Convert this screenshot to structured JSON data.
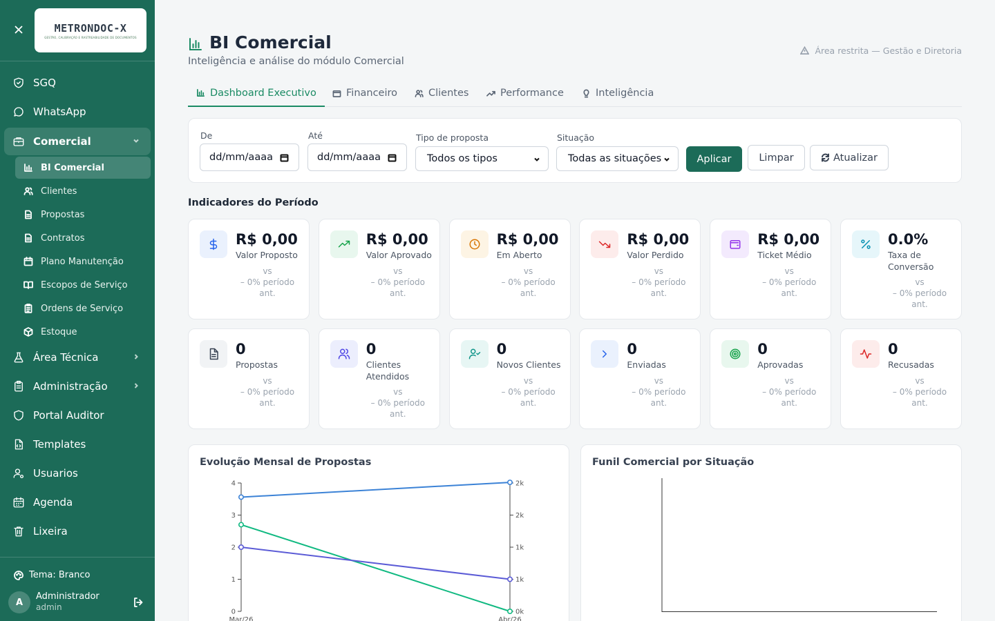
{
  "sidebar": {
    "logo_text": "METRONDOC-X",
    "logo_tagline": "GESTÃO, CALIBRAÇÃO E RASTREABILIDADE DE DOCUMENTOS",
    "items": [
      {
        "label": "SGQ",
        "icon": "shield-check-icon"
      },
      {
        "label": "WhatsApp",
        "icon": "chat-bubble-icon"
      },
      {
        "label": "Comercial",
        "icon": "briefcase-icon"
      },
      {
        "label": "Área Técnica",
        "icon": "flask-icon"
      },
      {
        "label": "Administração",
        "icon": "clipboard-icon"
      },
      {
        "label": "Portal Auditor",
        "icon": "shield-icon"
      },
      {
        "label": "Templates",
        "icon": "file-code-icon"
      },
      {
        "label": "Usuarios",
        "icon": "user-cog-icon"
      },
      {
        "label": "Agenda",
        "icon": "calendar-icon"
      },
      {
        "label": "Lixeira",
        "icon": "trash-icon"
      }
    ],
    "sub_items": [
      {
        "label": "BI Comercial",
        "icon": "bar-chart-icon"
      },
      {
        "label": "Clientes",
        "icon": "users-icon"
      },
      {
        "label": "Propostas",
        "icon": "file-text-icon"
      },
      {
        "label": "Contratos",
        "icon": "file-text-icon"
      },
      {
        "label": "Plano Manutenção",
        "icon": "calendar-icon"
      },
      {
        "label": "Escopos de Serviço",
        "icon": "book-icon"
      },
      {
        "label": "Ordens de Serviço",
        "icon": "clipboard-list-icon"
      },
      {
        "label": "Estoque",
        "icon": "package-icon"
      }
    ],
    "theme_label": "Tema: Branco",
    "user": {
      "initial": "A",
      "name": "Administrador",
      "role": "admin"
    }
  },
  "header": {
    "title": "BI Comercial",
    "subtitle": "Inteligência e análise do módulo Comercial",
    "restricted": "Área restrita — Gestão e Diretoria"
  },
  "tabs": [
    {
      "label": "Dashboard Executivo",
      "icon": "bar-chart-icon"
    },
    {
      "label": "Financeiro",
      "icon": "wallet-icon"
    },
    {
      "label": "Clientes",
      "icon": "users-icon"
    },
    {
      "label": "Performance",
      "icon": "trending-up-icon"
    },
    {
      "label": "Inteligência",
      "icon": "lightbulb-icon"
    }
  ],
  "filters": {
    "from_label": "De",
    "from_value": "dd/mm/aaaa",
    "to_label": "Até",
    "to_value": "dd/mm/aaaa",
    "type_label": "Tipo de proposta",
    "type_value": "Todos os tipos",
    "status_label": "Situação",
    "status_value": "Todas as situações",
    "apply": "Aplicar",
    "clear": "Limpar",
    "refresh": "Atualizar"
  },
  "section_title": "Indicadores do Período",
  "kpis": [
    {
      "value": "R$ 0,00",
      "label": "Valor Proposto",
      "icon": "dollar-icon",
      "color": "#2563eb",
      "bg": "#eaf1fd",
      "compare": [
        "vs",
        "– 0% período",
        "ant."
      ]
    },
    {
      "value": "R$ 0,00",
      "label": "Valor Aprovado",
      "icon": "trending-up-icon",
      "color": "#16a34a",
      "bg": "#e8f7ee",
      "compare": [
        "vs",
        "– 0% período",
        "ant."
      ]
    },
    {
      "value": "R$ 0,00",
      "label": "Em Aberto",
      "icon": "clock-icon",
      "color": "#d97706",
      "bg": "#fdf4e4",
      "compare": [
        "vs",
        "– 0% período",
        "ant."
      ]
    },
    {
      "value": "R$ 0,00",
      "label": "Valor Perdido",
      "icon": "trending-down-icon",
      "color": "#dc2626",
      "bg": "#fdeceb",
      "compare": [
        "vs",
        "– 0% período",
        "ant."
      ]
    },
    {
      "value": "R$ 0,00",
      "label": "Ticket Médio",
      "icon": "wallet-icon",
      "color": "#9333ea",
      "bg": "#f3eafd",
      "compare": [
        "vs",
        "– 0% período",
        "ant."
      ]
    },
    {
      "value": "0.0%",
      "label": "Taxa de Conversão",
      "icon": "percent-icon",
      "color": "#0891b2",
      "bg": "#e6f6fa",
      "compare": [
        "vs",
        "– 0% período",
        "ant."
      ]
    },
    {
      "value": "0",
      "label": "Propostas",
      "icon": "file-text-icon",
      "color": "#374151",
      "bg": "#f1f3f5",
      "compare": [
        "vs",
        "– 0% período",
        "ant."
      ]
    },
    {
      "value": "0",
      "label": "Clientes Atendidos",
      "icon": "users-icon",
      "color": "#4f46e5",
      "bg": "#eceefd",
      "compare": [
        "vs",
        "– 0% período",
        "ant."
      ]
    },
    {
      "value": "0",
      "label": "Novos Clientes",
      "icon": "user-check-icon",
      "color": "#0d9488",
      "bg": "#e7f6f4",
      "compare": [
        "vs",
        "– 0% período",
        "ant."
      ]
    },
    {
      "value": "0",
      "label": "Enviadas",
      "icon": "chevron-right-icon",
      "color": "#2563eb",
      "bg": "#eaf1fd",
      "compare": [
        "vs",
        "– 0% período",
        "ant."
      ]
    },
    {
      "value": "0",
      "label": "Aprovadas",
      "icon": "target-icon",
      "color": "#16a34a",
      "bg": "#e8f7ee",
      "compare": [
        "vs",
        "– 0% período",
        "ant."
      ]
    },
    {
      "value": "0",
      "label": "Recusadas",
      "icon": "activity-icon",
      "color": "#dc2626",
      "bg": "#fdeceb",
      "compare": [
        "vs",
        "– 0% período",
        "ant."
      ]
    }
  ],
  "chart_evolution": {
    "title": "Evolução Mensal de Propostas"
  },
  "chart_funnel": {
    "title": "Funil Comercial por Situação"
  },
  "chart_data": [
    {
      "type": "line",
      "title": "Evolução Mensal de Propostas",
      "x": [
        "Mar/26",
        "Abr/26"
      ],
      "y_left_ticks": [
        "0",
        "1",
        "2",
        "3",
        "4"
      ],
      "y_left_range": [
        0,
        4
      ],
      "y_right_ticks": [
        "0k",
        "1k",
        "1k",
        "2k",
        "2k"
      ],
      "y_right_range": [
        0,
        2000
      ],
      "series": [
        {
          "axis": "right",
          "color": "#3b82d6",
          "values": [
            1780,
            2010
          ]
        },
        {
          "axis": "left",
          "color": "#10b981",
          "values": [
            2.7,
            0
          ]
        },
        {
          "axis": "left",
          "color": "#5b5bd6",
          "values": [
            2,
            1
          ]
        }
      ]
    },
    {
      "type": "bar",
      "title": "Funil Comercial por Situação",
      "categories": [],
      "values": []
    }
  ]
}
